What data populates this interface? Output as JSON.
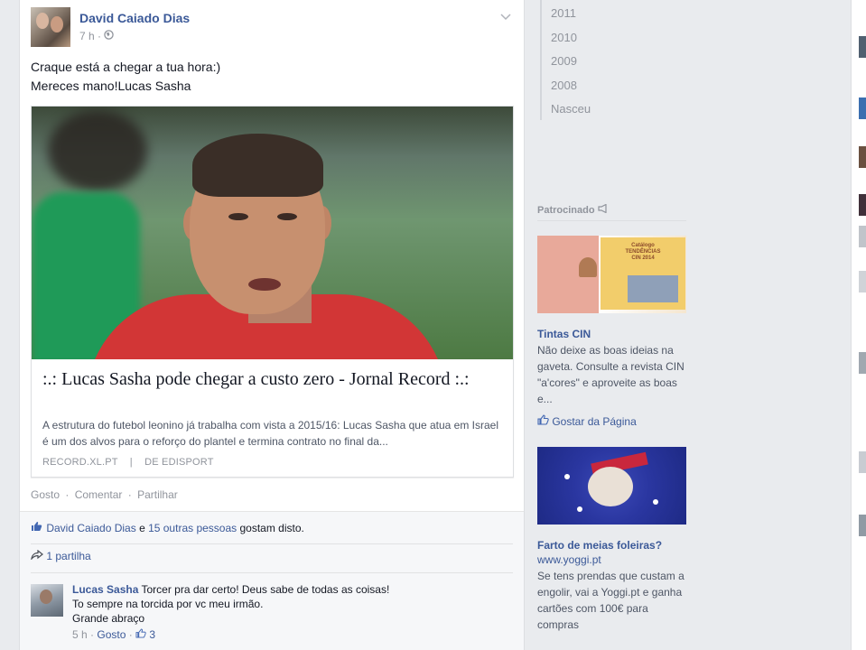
{
  "post": {
    "author": "David Caiado Dias",
    "time": "7 h",
    "privacy_icon": "globe-icon",
    "text_line1": "Craque está a chegar a tua hora:)",
    "text_line2": "Mereces mano!Lucas Sasha",
    "link": {
      "title": ":.: Lucas Sasha pode chegar a custo zero - Jornal Record :.:",
      "description": "A estrutura do futebol leonino já trabalha com vista a 2015/16: Lucas Sasha que atua em Israel é um dos alvos para o reforço do plantel e termina contrato no final da...",
      "source": "RECORD.XL.PT",
      "separator": "|",
      "via": "DE EDISPORT"
    },
    "actions": {
      "like": "Gosto",
      "comment": "Comentar",
      "share": "Partilhar",
      "dot": "·"
    },
    "likes": {
      "name": "David Caiado Dias",
      "conj": " e ",
      "others": "15 outras pessoas",
      "suffix": " gostam disto."
    },
    "shares": "1 partilha",
    "comment": {
      "name": "Lucas Sasha",
      "text_line1": " Torcer pra dar certo! Deus sabe de todas as coisas!",
      "text_line2": "To sempre na torcida por vc meu irmão.",
      "text_line3": "Grande abraço",
      "time": "5 h",
      "dot": " · ",
      "like": "Gosto",
      "like_count": "3"
    }
  },
  "timeline_years": [
    "2011",
    "2010",
    "2009",
    "2008",
    "Nasceu"
  ],
  "sponsored": {
    "header": "Patrocinado",
    "ads": [
      {
        "image_text_line1": "Catálogo",
        "image_text_line2": "TENDÊNCIAS",
        "image_text_line3": "CIN 2014",
        "title": "Tintas CIN",
        "description": "Não deixe as boas ideias na gaveta. Consulte a revista CIN \"a'cores\" e aproveite as boas e...",
        "like_label": "Gostar da Página"
      },
      {
        "title": "Farto de meias foleiras?",
        "url": "www.yoggi.pt",
        "description": "Se tens prendas que custam a engolir, vai a Yoggi.pt e ganha cartões com 100€ para compras"
      }
    ]
  }
}
